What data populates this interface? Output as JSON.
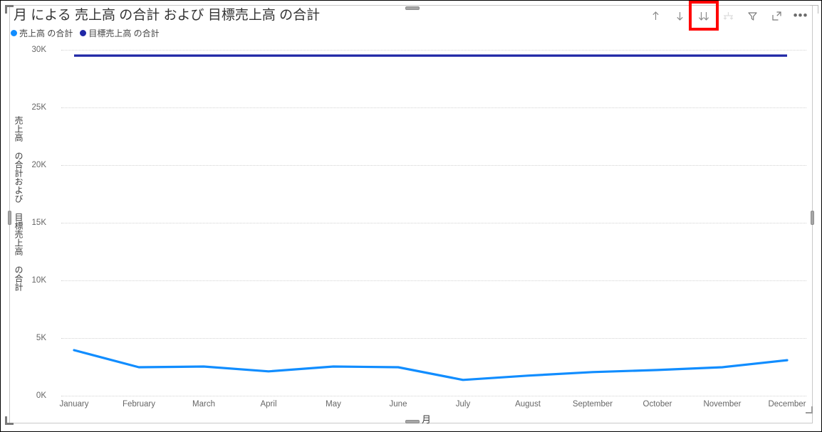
{
  "visual": {
    "title": "月 による 売上高 の合計 および 目標売上高 の合計",
    "type": "line-chart"
  },
  "legend": {
    "items": [
      {
        "label": "売上高 の合計",
        "color": "#118DFF"
      },
      {
        "label": "目標売上高 の合計",
        "color": "#1F27A6"
      }
    ]
  },
  "toolbar": {
    "drill_up_label": "drill-up",
    "drill_down_label": "drill-down",
    "expand_all_label": "expand-all-down-one-level",
    "go_next_level_label": "go-to-next-level-in-hierarchy",
    "filter_label": "filters",
    "focus_label": "focus-mode",
    "more_label": "more-options",
    "more_glyph": "•••",
    "highlighted_button": "expand-all-down-one-level",
    "highlight_color": "#FF0000"
  },
  "chart_data": {
    "type": "line",
    "title": "月 による 売上高 の合計 および 目標売上高 の合計",
    "xlabel": "月",
    "ylabel": "売上高 の合計および 目標売上高 の合計",
    "categories": [
      "January",
      "February",
      "March",
      "April",
      "May",
      "June",
      "July",
      "August",
      "September",
      "October",
      "November",
      "December"
    ],
    "series": [
      {
        "name": "売上高 の合計",
        "color": "#118DFF",
        "values": [
          3980,
          2500,
          2560,
          2140,
          2560,
          2500,
          1400,
          1770,
          2080,
          2260,
          2500,
          3110
        ]
      },
      {
        "name": "目標売上高 の合計",
        "color": "#1F27A6",
        "values": [
          29500,
          29500,
          29500,
          29500,
          29500,
          29500,
          29500,
          29500,
          29500,
          29500,
          29500,
          29500
        ]
      }
    ],
    "ylim": [
      0,
      30000
    ],
    "yticks": [
      "0K",
      "5K",
      "10K",
      "15K",
      "20K",
      "25K",
      "30K"
    ],
    "ytick_values": [
      0,
      5000,
      10000,
      15000,
      20000,
      25000,
      30000
    ],
    "grid": true,
    "legend_position": "top-left"
  }
}
